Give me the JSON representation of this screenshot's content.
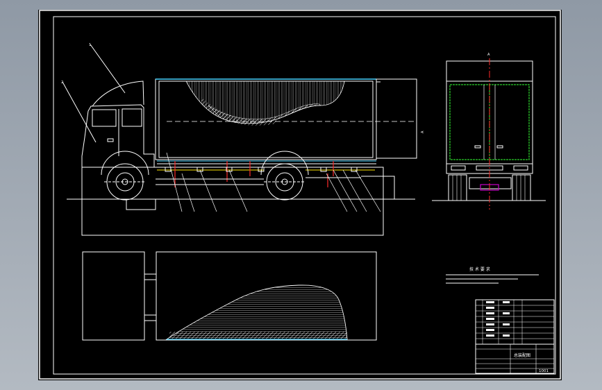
{
  "drawing": {
    "title_block": {
      "title": "总装配图",
      "drawing_no": "1001"
    },
    "tech_req_title": "技 术 要 求"
  },
  "colors": {
    "background": "#000000",
    "line": "#ffffff",
    "hatch": "#ffffff",
    "accent_cyan": "#49d3ff",
    "accent_red": "#ff2a2a",
    "accent_yellow": "#ffe600",
    "accent_green": "#2bd12b",
    "accent_magenta": "#c800c8"
  }
}
